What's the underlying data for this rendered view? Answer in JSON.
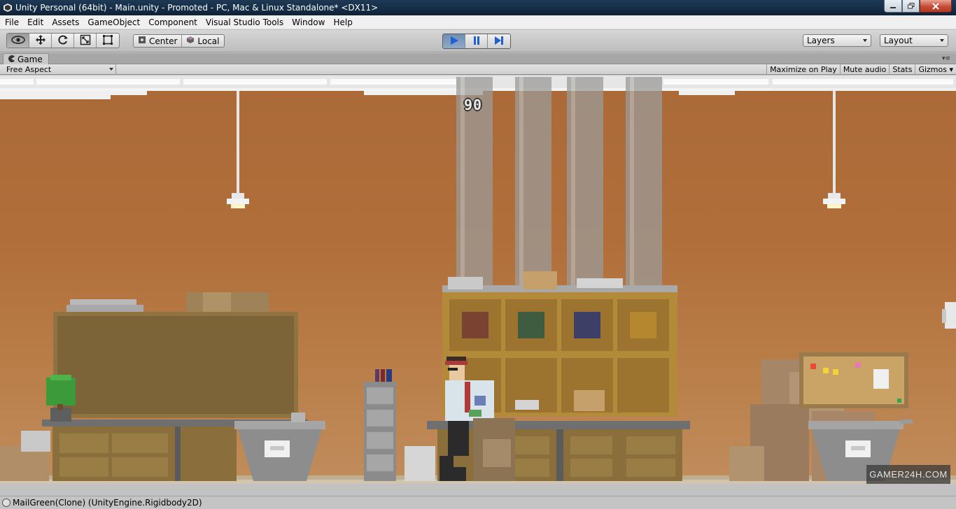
{
  "window": {
    "title": "Unity Personal (64bit) - Main.unity - Promoted - PC, Mac & Linux Standalone* <DX11>"
  },
  "menu": [
    "File",
    "Edit",
    "Assets",
    "GameObject",
    "Component",
    "Visual Studio Tools",
    "Window",
    "Help"
  ],
  "toolbar": {
    "tools": [
      "hand-tool",
      "move-tool",
      "rotate-tool",
      "scale-tool",
      "rect-tool"
    ],
    "pivot_label": "Center",
    "space_label": "Local",
    "layers_label": "Layers",
    "layout_label": "Layout"
  },
  "game_tab": {
    "tab_label": "Game",
    "aspect_label": "Free Aspect",
    "maximize_label": "Maximize on Play",
    "mute_label": "Mute audio",
    "stats_label": "Stats",
    "gizmos_label": "Gizmos"
  },
  "game": {
    "score": "90",
    "watermark": "GAMER24H.COM",
    "colors": {
      "wall": "#b06e3a",
      "floor": "#cbb99c",
      "cabinet": "#8f7442",
      "shelf": "#b38a3a",
      "chute": "#9c9b98",
      "metal": "#8d8d8d"
    },
    "box_colors": [
      "#7a4230",
      "#3f5c41",
      "#3d3f66",
      "#b5882f"
    ]
  },
  "status": {
    "message": "MailGreen(Clone) (UnityEngine.Rigidbody2D)"
  },
  "icons": {
    "unity": "unity-logo-icon",
    "play": "play-icon",
    "pause": "pause-icon",
    "step": "step-icon"
  }
}
